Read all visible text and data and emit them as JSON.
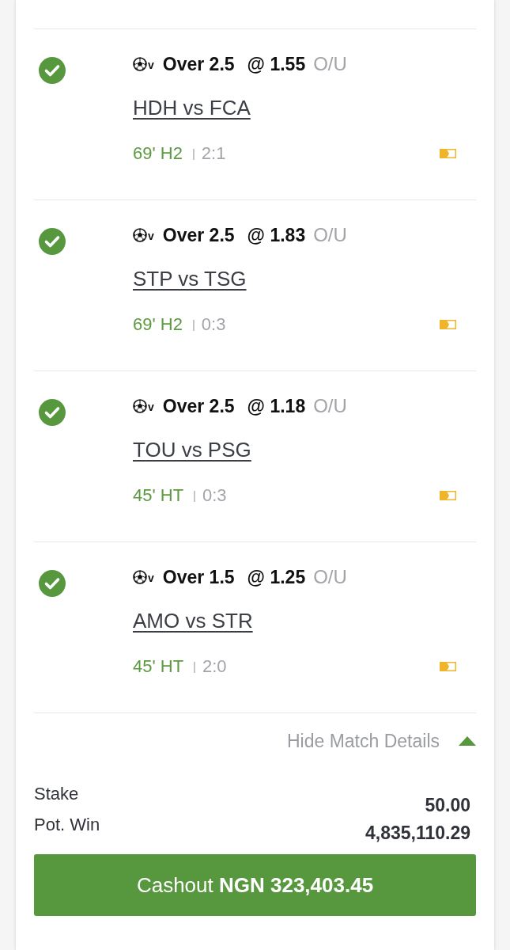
{
  "legs": [
    {
      "won": true,
      "sport_suffix": "v",
      "selection": "Over 2.5",
      "odds": "@ 1.55",
      "market": "O/U",
      "match": "HDH vs FCA",
      "clock": "69' H2",
      "separator": "|",
      "score": "2:1"
    },
    {
      "won": true,
      "sport_suffix": "v",
      "selection": "Over 2.5",
      "odds": "@ 1.83",
      "market": "O/U",
      "match": "STP vs TSG",
      "clock": "69' H2",
      "separator": "|",
      "score": "0:3"
    },
    {
      "won": true,
      "sport_suffix": "v",
      "selection": "Over 2.5",
      "odds": "@ 1.18",
      "market": "O/U",
      "match": "TOU vs PSG",
      "clock": "45' HT",
      "separator": "|",
      "score": "0:3"
    },
    {
      "won": true,
      "sport_suffix": "v",
      "selection": "Over 1.5",
      "odds": "@ 1.25",
      "market": "O/U",
      "match": "AMO vs STR",
      "clock": "45' HT",
      "separator": "|",
      "score": "2:0"
    }
  ],
  "details_toggle": {
    "label": "Hide Match Details",
    "expanded": true
  },
  "summary": [
    {
      "label": "Stake",
      "value": "50.00"
    },
    {
      "label": "Pot. Win",
      "value": "4,835,110.29"
    }
  ],
  "cashout_button": "Cashout **NGN 323,403.45**"
}
